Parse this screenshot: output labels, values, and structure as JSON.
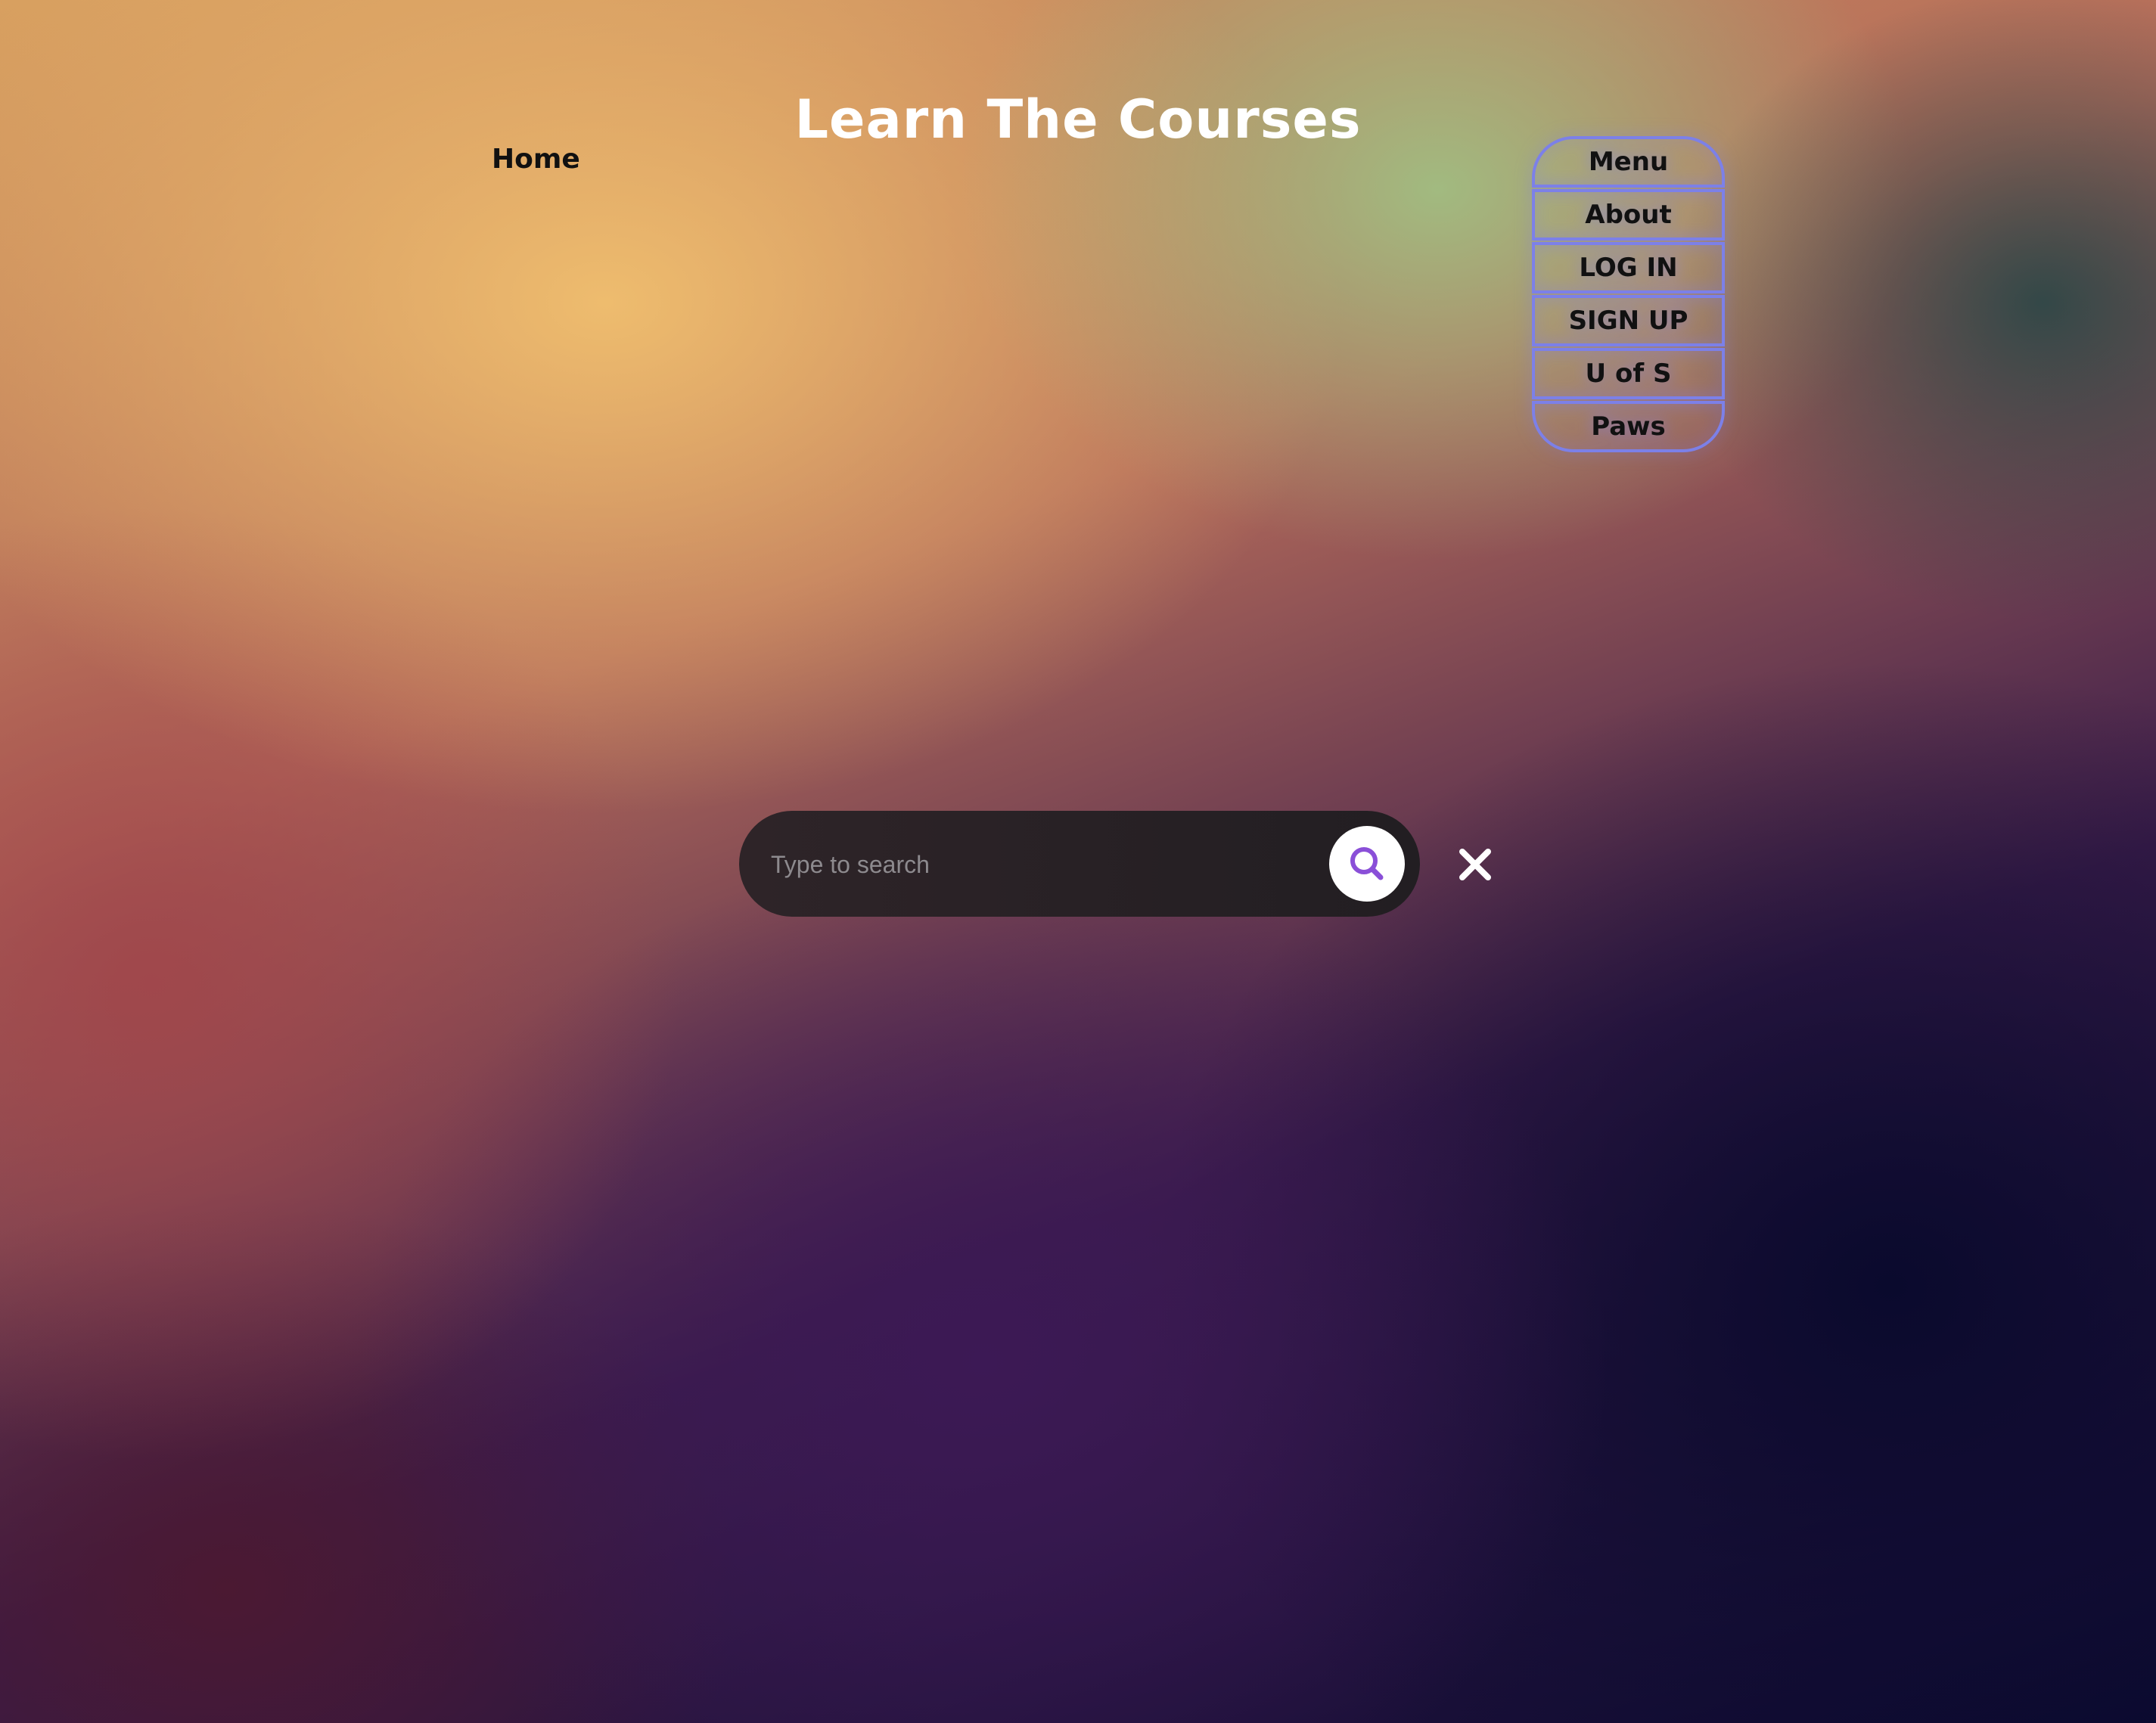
{
  "header": {
    "title": "Learn The Courses"
  },
  "nav": {
    "home_label": "Home"
  },
  "menu": {
    "items": [
      {
        "label": "Menu"
      },
      {
        "label": "About"
      },
      {
        "label": "LOG IN"
      },
      {
        "label": "SIGN UP"
      },
      {
        "label": "U of S"
      },
      {
        "label": "Paws"
      }
    ],
    "border_color": "#7c80e8"
  },
  "search": {
    "placeholder": "Type to search",
    "value": "",
    "button_icon": "search-icon",
    "accent_color": "#8a4fd8",
    "close_icon": "close-icon"
  }
}
